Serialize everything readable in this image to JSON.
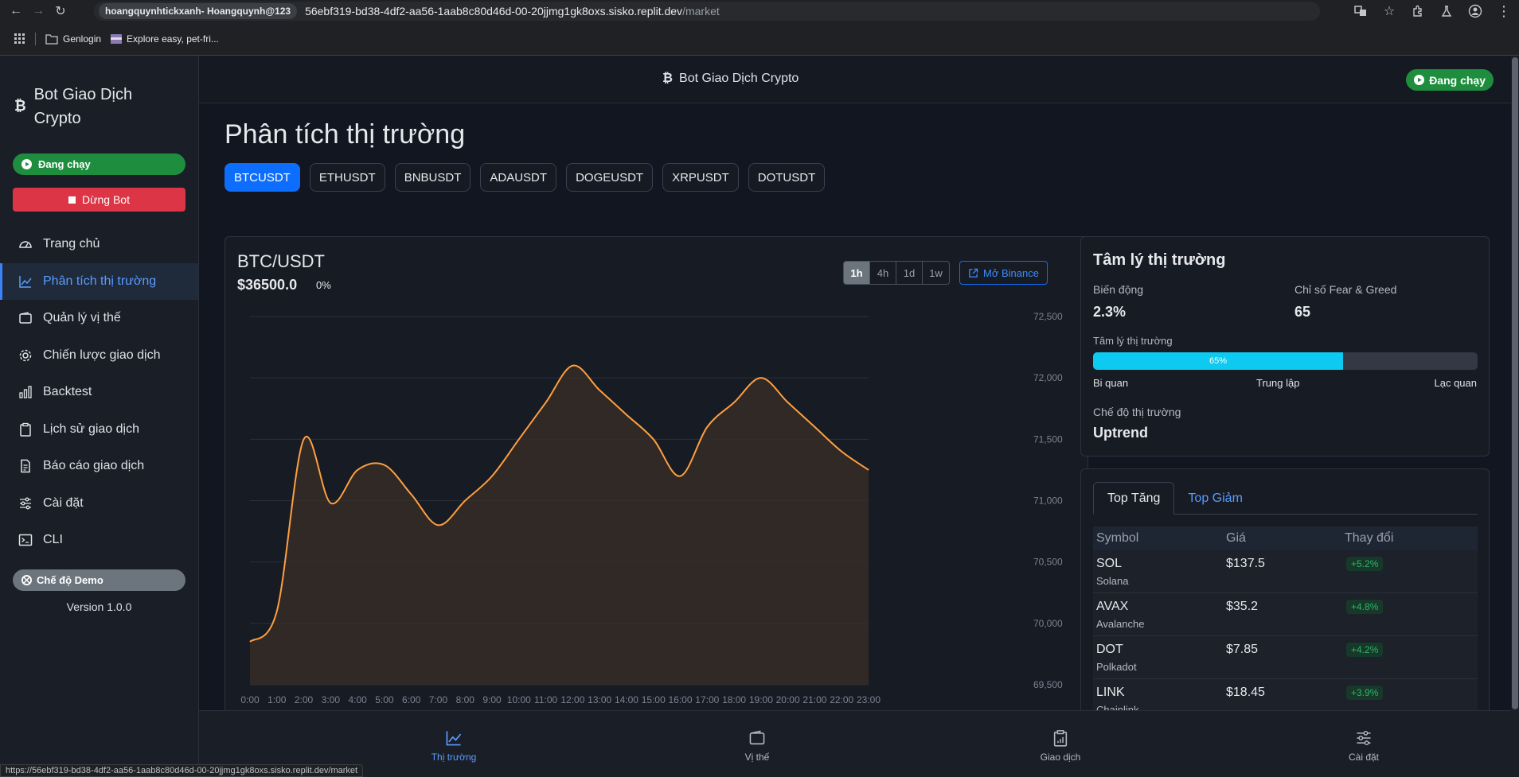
{
  "browser": {
    "profile_chip": "hoangquynhtickxanh- Hoangquynh@123",
    "url_main": "56ebf319-bd38-4df2-aa56-1aab8c80d46d-00-20jjmg1gk8oxs.sisko.replit.dev",
    "url_path": "/market",
    "bookmarks": [
      "Genlogin",
      "Explore easy, pet-fri..."
    ],
    "status_url": "https://56ebf319-bd38-4df2-aa56-1aab8c80d46d-00-20jjmg1gk8oxs.sisko.replit.dev/market"
  },
  "sidebar": {
    "brand": "Bot Giao Dịch Crypto",
    "running": "Đang chạy",
    "stop": "Dừng Bot",
    "items": [
      {
        "label": "Trang chủ",
        "icon": "gauge-icon"
      },
      {
        "label": "Phân tích thị trường",
        "icon": "chart-line-icon"
      },
      {
        "label": "Quản lý vị thế",
        "icon": "wallet-icon"
      },
      {
        "label": "Chiến lược giao dịch",
        "icon": "gear-icon"
      },
      {
        "label": "Backtest",
        "icon": "bar-chart-icon"
      },
      {
        "label": "Lịch sử giao dịch",
        "icon": "clipboard-icon"
      },
      {
        "label": "Báo cáo giao dịch",
        "icon": "document-icon"
      },
      {
        "label": "Cài đặt",
        "icon": "sliders-icon"
      },
      {
        "label": "CLI",
        "icon": "terminal-icon"
      }
    ],
    "demo": "Chế độ Demo",
    "version": "Version 1.0.0"
  },
  "header": {
    "title": "Bot Giao Dịch Crypto",
    "status": "Đang chạy"
  },
  "main": {
    "title": "Phân tích thị trường",
    "symbols": [
      "BTCUSDT",
      "ETHUSDT",
      "BNBUSDT",
      "ADAUSDT",
      "DOGEUSDT",
      "XRPUSDT",
      "DOTUSDT"
    ],
    "active_symbol": "BTCUSDT"
  },
  "chart_card": {
    "pair": "BTC/USDT",
    "price": "$36500.0",
    "change": "0%",
    "timeframes": [
      "1h",
      "4h",
      "1d",
      "1w"
    ],
    "active_timeframe": "1h",
    "binance": "Mở Binance"
  },
  "chart_data": {
    "type": "area",
    "x": [
      "0:00",
      "1:00",
      "2:00",
      "3:00",
      "4:00",
      "5:00",
      "6:00",
      "7:00",
      "8:00",
      "9:00",
      "10:00",
      "11:00",
      "12:00",
      "13:00",
      "14:00",
      "15:00",
      "16:00",
      "17:00",
      "18:00",
      "19:00",
      "20:00",
      "21:00",
      "22:00",
      "23:00"
    ],
    "values": [
      69850,
      70100,
      71500,
      70980,
      71250,
      71290,
      71050,
      70800,
      71000,
      71200,
      71500,
      71800,
      72100,
      71900,
      71700,
      71500,
      71200,
      71600,
      71800,
      72000,
      71800,
      71600,
      71400,
      71250
    ],
    "ylim": [
      69500,
      72500
    ],
    "yticks": [
      "72,500",
      "72,000",
      "71,500",
      "71,000",
      "70,500",
      "70,000",
      "69,500"
    ],
    "color": "#ff9f40",
    "grid": true
  },
  "sentiment": {
    "title": "Tâm lý thị trường",
    "volatility_label": "Biến động",
    "volatility": "2.3%",
    "fear_greed_label": "Chỉ số Fear & Greed",
    "fear_greed": "65",
    "mood_label": "Tâm lý thị trường",
    "mood_pct": 65,
    "mood_text": "65%",
    "scale": [
      "Bi quan",
      "Trung lập",
      "Lạc quan"
    ],
    "regime_label": "Chế độ thị trường",
    "regime": "Uptrend"
  },
  "top_movers": {
    "tabs": [
      "Top Tăng",
      "Top Giảm"
    ],
    "headers": [
      "Symbol",
      "Giá",
      "Thay đổi"
    ],
    "rows": [
      {
        "symbol": "SOL",
        "name": "Solana",
        "price": "$137.5",
        "change": "+5.2%"
      },
      {
        "symbol": "AVAX",
        "name": "Avalanche",
        "price": "$35.2",
        "change": "+4.8%"
      },
      {
        "symbol": "DOT",
        "name": "Polkadot",
        "price": "$7.85",
        "change": "+4.2%"
      },
      {
        "symbol": "LINK",
        "name": "Chainlink",
        "price": "$18.45",
        "change": "+3.9%"
      }
    ]
  },
  "bottom_nav": [
    {
      "label": "Thị trường",
      "icon": "chart-line-icon"
    },
    {
      "label": "Vị thế",
      "icon": "wallet-icon"
    },
    {
      "label": "Giao dịch",
      "icon": "clipboard-icon"
    },
    {
      "label": "Cài đặt",
      "icon": "sliders-icon"
    }
  ]
}
